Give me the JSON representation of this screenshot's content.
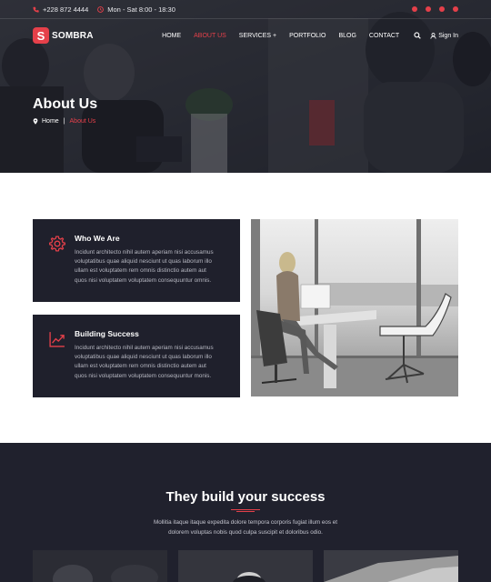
{
  "topbar": {
    "phone": "+228 872 4444",
    "hours": "Mon - Sat 8:00 - 18:30",
    "socials": [
      "facebook-icon",
      "twitter-icon",
      "instagram-icon",
      "whatsapp-icon"
    ]
  },
  "brand": {
    "logo_letter": "S",
    "name": "SOMBRA"
  },
  "nav": {
    "items": [
      {
        "label": "HOME"
      },
      {
        "label": "ABOUT US"
      },
      {
        "label": "SERVICES +"
      },
      {
        "label": "PORTFOLIO"
      },
      {
        "label": "BLOG"
      },
      {
        "label": "CONTACT"
      }
    ],
    "active_index": 1,
    "signin": "Sign In"
  },
  "hero": {
    "title": "About Us",
    "breadcrumb": {
      "home": "Home",
      "separator": "|",
      "current": "About Us"
    }
  },
  "cards": [
    {
      "icon": "gear-icon",
      "title": "Who We Are",
      "lines": [
        "Incidunt architecto nihil autem aperiam nisi accusamus",
        "voluptatibus quae aliquid nesciunt ut quas laborum illo",
        "ullam est voluptatem rem omnis distinctio autem aut",
        "quos nisi voluptatem voluptatem consequuntur omnis."
      ]
    },
    {
      "icon": "growth-chart-icon",
      "title": "Building Success",
      "lines": [
        "Incidunt architecto nihil autem aperiam nisi accusamus",
        "voluptatibus quae aliquid nesciunt ut quas laborum illo",
        "ullam est voluptatem rem omnis distinctio autem aut",
        "quos nisi voluptatem voluptatem consequuntur monis."
      ]
    }
  ],
  "team": {
    "title": "They build your success",
    "desc_lines": [
      "Mollitia itaque itaque expedita dolore tempora corporis fugiat illum eos et",
      "dolorem voluptas nobis quod culpa suscipit et doloribus odio."
    ]
  },
  "colors": {
    "accent": "#e5404a",
    "dark_card": "#1f202c",
    "dark_section": "#20212d",
    "white": "#ffffff"
  }
}
